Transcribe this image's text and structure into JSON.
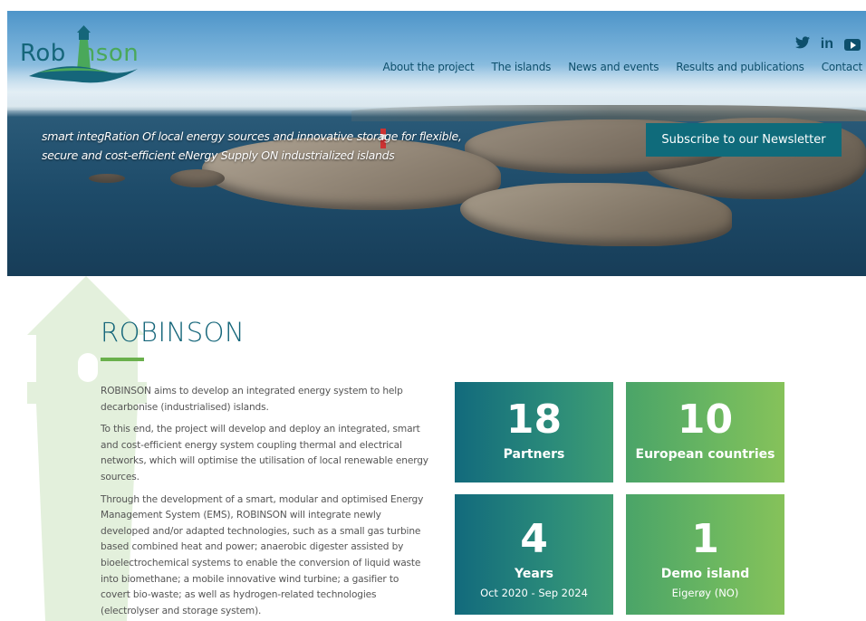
{
  "header": {
    "logo_text_1": "Rob",
    "logo_text_2": "nson",
    "nav": [
      "About the project",
      "The islands",
      "News and events",
      "Results and publications",
      "Contact"
    ],
    "social": [
      "twitter-icon",
      "linkedin-icon",
      "youtube-icon"
    ],
    "linkedin_label": "in"
  },
  "hero": {
    "tagline_line1": "smart integRation Of local energy sources and innovative storage for flexible,",
    "tagline_line2": "secure and cost-efficient eNergy Supply ON industrialized islands",
    "subscribe_label": "Subscribe to our Newsletter"
  },
  "main": {
    "title": "ROBINSON",
    "paragraphs": [
      "ROBINSON aims to develop an integrated energy system to help decarbonise (industrialised) islands.",
      "To this end, the project will develop and deploy an integrated, smart and cost-efficient energy system coupling thermal and electrical networks, which will optimise the utilisation of local renewable energy sources.",
      "Through the development of a smart, modular and optimised Energy Management System (EMS), ROBINSON will integrate newly developed and/or adapted technologies, such as a small gas turbine based combined heat and power; anaerobic digester assisted by bioelectrochemical systems to enable the conversion of liquid waste into biomethane; a mobile innovative wind turbine; a gasifier to covert bio-waste; as well as hydrogen-related technologies (electrolyser and storage system)."
    ]
  },
  "stats": [
    {
      "number": "18",
      "label": "Partners",
      "sub": ""
    },
    {
      "number": "10",
      "label": "European countries",
      "sub": ""
    },
    {
      "number": "4",
      "label": "Years",
      "sub": "Oct 2020 - Sep 2024"
    },
    {
      "number": "1",
      "label": "Demo island",
      "sub": "Eigerøy (NO)"
    }
  ],
  "colors": {
    "brand_teal": "#15667a",
    "brand_green": "#6ab04c",
    "nav_text": "#0d4f6c",
    "button_bg": "#0f6b7b"
  }
}
